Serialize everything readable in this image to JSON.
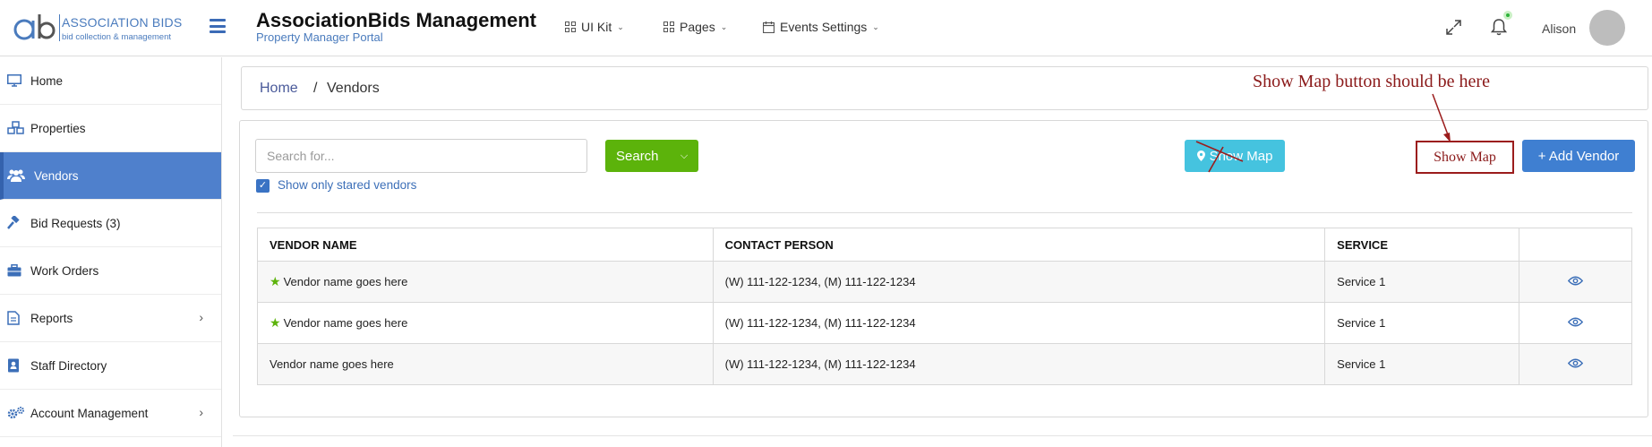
{
  "header": {
    "logo_brand": "ASSOCIATION BIDS",
    "logo_tagline": "bid collection & management",
    "title": "AssociationBids Management",
    "subtitle": "Property Manager Portal",
    "nav": [
      {
        "label": "UI Kit",
        "icon": "grid-icon"
      },
      {
        "label": "Pages",
        "icon": "grid-icon"
      },
      {
        "label": "Events Settings",
        "icon": "calendar-icon"
      }
    ],
    "user_name": "Alison"
  },
  "sidebar": {
    "items": [
      {
        "label": "Home",
        "icon": "monitor-icon"
      },
      {
        "label": "Properties",
        "icon": "cubes-icon"
      },
      {
        "label": "Vendors",
        "icon": "users-icon",
        "active": true
      },
      {
        "label": "Bid Requests (3)",
        "icon": "gavel-icon"
      },
      {
        "label": "Work Orders",
        "icon": "briefcase-icon"
      },
      {
        "label": "Reports",
        "icon": "document-icon",
        "has_submenu": true
      },
      {
        "label": "Staff Directory",
        "icon": "contact-book-icon"
      },
      {
        "label": "Account Management",
        "icon": "gears-icon",
        "has_submenu": true
      }
    ]
  },
  "breadcrumb": {
    "home": "Home",
    "separator": "/",
    "current": "Vendors"
  },
  "toolbar": {
    "search_placeholder": "Search for...",
    "search_label": "Search",
    "starred_filter_label": "Show only stared vendors",
    "show_map_label": "Show Map",
    "add_vendor_label": "+ Add Vendor"
  },
  "annotation": {
    "note": "Show Map button should be here",
    "box_label": "Show Map"
  },
  "table": {
    "headers": [
      "VENDOR NAME",
      "CONTACT PERSON",
      "SERVICE",
      ""
    ],
    "rows": [
      {
        "starred": true,
        "vendor": "Vendor name goes here",
        "contact": "(W) 111-122-1234, (M) 111-122-1234",
        "service": "Service 1"
      },
      {
        "starred": true,
        "vendor": "Vendor name goes here",
        "contact": "(W) 111-122-1234, (M) 111-122-1234",
        "service": "Service 1"
      },
      {
        "starred": false,
        "vendor": "Vendor name goes here",
        "contact": "(W) 111-122-1234, (M) 111-122-1234",
        "service": "Service 1"
      }
    ]
  },
  "colors": {
    "primary": "#3f7fd1",
    "sidebar_active": "#4f80cc",
    "search_green": "#5cb30b",
    "map_cyan": "#45c3df",
    "annotation_red": "#8b1a1a"
  }
}
